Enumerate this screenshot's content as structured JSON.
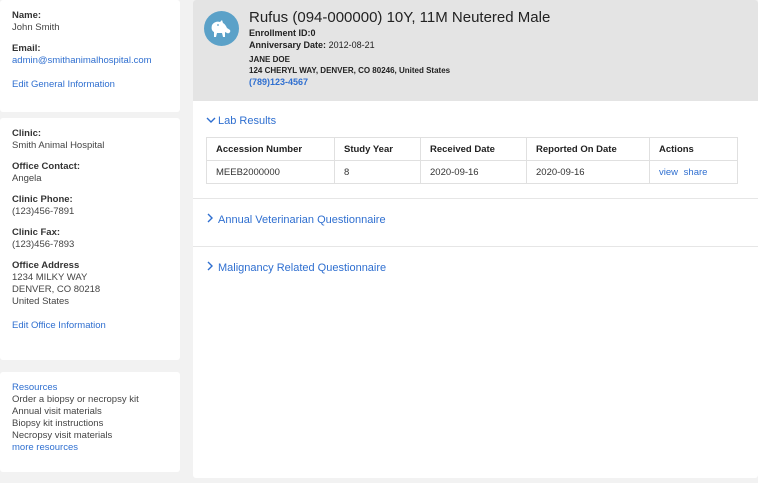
{
  "sidebar": {
    "user": {
      "name_label": "Name:",
      "name": "John Smith",
      "email_label": "Email:",
      "email": "admin@smithanimalhospital.com",
      "edit_link": "Edit General Information"
    },
    "clinic": {
      "clinic_label": "Clinic:",
      "clinic": "Smith Animal Hospital",
      "contact_label": "Office Contact:",
      "contact": "Angela",
      "phone_label": "Clinic Phone:",
      "phone": "(123)456-7891",
      "fax_label": "Clinic Fax:",
      "fax": "(123)456-7893",
      "address_label": "Office Address",
      "address_line1": "1234 MILKY WAY",
      "address_line2": "DENVER, CO 80218",
      "address_line3": "United States",
      "edit_link": "Edit Office Information"
    },
    "resources": {
      "title": "Resources",
      "items": [
        "Order a biopsy or necropsy kit",
        "Annual visit materials",
        "Biopsy kit instructions",
        "Necropsy visit materials"
      ],
      "more": "more resources"
    }
  },
  "patient": {
    "title": "Rufus (094-000000) 10Y, 11M Neutered Male",
    "enrollment": "Enrollment ID:0",
    "anniversary_label": "Anniversary Date:",
    "anniversary": "2012-08-21",
    "owner": "JANE DOE",
    "address": "124 CHERYL WAY,  DENVER, CO 80246,  United States",
    "phone": "(789)123-4567",
    "avatar_icon": "dog-icon"
  },
  "sections": {
    "lab_results": "Lab Results",
    "annual": "Annual Veterinarian Questionnaire",
    "malignancy": "Malignancy Related Questionnaire"
  },
  "lab_table": {
    "headers": [
      "Accession Number",
      "Study Year",
      "Received Date",
      "Reported On Date",
      "Actions"
    ],
    "rows": [
      {
        "accession": "MEEB2000000",
        "year": "8",
        "received": "2020-09-16",
        "reported": "2020-09-16",
        "view": "view",
        "share": "share"
      }
    ]
  },
  "colors": {
    "link": "#2f6fd0",
    "header_bg": "#e4e4e4",
    "avatar_bg": "#5ba1c8",
    "page_bg": "#f2f2f2"
  }
}
